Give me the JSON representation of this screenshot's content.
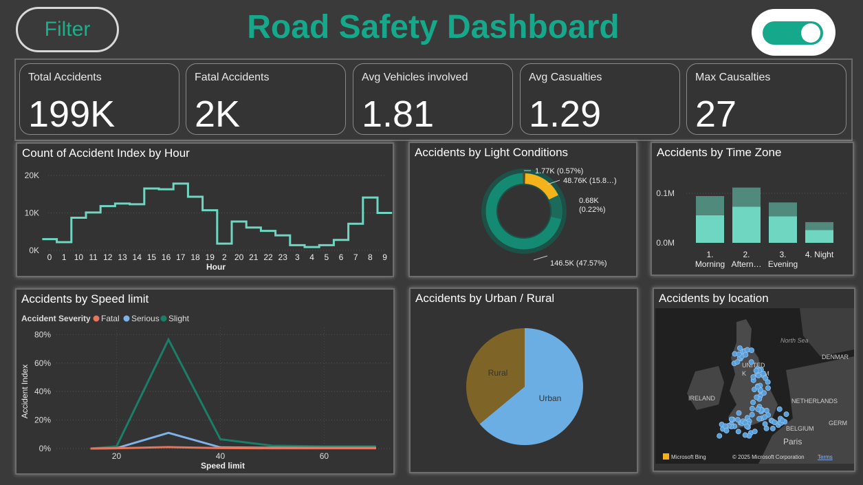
{
  "header": {
    "filter_label": "Filter",
    "title": "Road Safety Dashboard",
    "toggle_state": "on"
  },
  "kpis": [
    {
      "label": "Total Accidents",
      "value": "199K"
    },
    {
      "label": "Fatal Accidents",
      "value": "2K"
    },
    {
      "label": "Avg Vehicles involved",
      "value": "1.81"
    },
    {
      "label": "Avg Casualties",
      "value": "1.29"
    },
    {
      "label": "Max Causalties",
      "value": "27"
    }
  ],
  "colors": {
    "accent": "#16a88a",
    "line": "#6fd6c1",
    "fatal": "#e8745a",
    "serious": "#7fb2e6",
    "slight": "#1a7e68",
    "amber": "#f4b21b",
    "urban": "#6aaee3",
    "rural": "#7e6426"
  },
  "hour_chart": {
    "title": "Count of Accident Index by Hour",
    "chart_data": {
      "type": "line",
      "x": [
        "0",
        "1",
        "10",
        "11",
        "12",
        "13",
        "14",
        "15",
        "16",
        "17",
        "18",
        "19",
        "2",
        "20",
        "21",
        "22",
        "23",
        "3",
        "4",
        "5",
        "6",
        "7",
        "8",
        "9"
      ],
      "values": [
        3000,
        2200,
        8700,
        10100,
        11800,
        12500,
        12300,
        16500,
        16300,
        17800,
        14300,
        10700,
        1800,
        7700,
        6100,
        5200,
        4000,
        1400,
        900,
        1400,
        2800,
        7100,
        14100,
        10000
      ],
      "xlabel": "Hour",
      "yticks": [
        "0K",
        "10K",
        "20K"
      ],
      "ylim": [
        0,
        22000
      ]
    }
  },
  "light_chart": {
    "title": "Accidents by Light Conditions",
    "chart_data": {
      "type": "pie",
      "slices": [
        {
          "label": "1.77K (0.57%)",
          "value": 1.77
        },
        {
          "label": "48.76K (15.8…)",
          "value": 48.76
        },
        {
          "label": "0.68K (0.22%)",
          "value": 0.68
        },
        {
          "label": "146.5K (47.57%)",
          "value": 146.5
        }
      ]
    }
  },
  "timezone_chart": {
    "title": "Accidents by Time Zone",
    "chart_data": {
      "type": "bar",
      "categories": [
        "1. Morning",
        "2. Aftern…",
        "3. Evening",
        "4. Night"
      ],
      "category_lines": [
        [
          "1.",
          "Morning"
        ],
        [
          "2.",
          "Aftern…"
        ],
        [
          "3.",
          "Evening"
        ],
        [
          "4. Night",
          ""
        ]
      ],
      "series": [
        {
          "values": [
            0.052,
            0.068,
            0.05,
            0.024
          ]
        },
        {
          "values": [
            0.036,
            0.036,
            0.026,
            0.015
          ]
        }
      ],
      "yticks": [
        "0.0M",
        "0.1M"
      ],
      "ylim": [
        0,
        0.11
      ]
    }
  },
  "speed_chart": {
    "title": "Accidents by Speed limit",
    "legend_title": "Accident Severity",
    "chart_data": {
      "type": "line",
      "x": [
        15,
        20,
        30,
        40,
        50,
        60,
        70
      ],
      "series": [
        {
          "name": "Fatal",
          "values": [
            0,
            0.2,
            1,
            0.3,
            0.2,
            0.2,
            0.2
          ]
        },
        {
          "name": "Serious",
          "values": [
            0,
            0.3,
            11,
            0.8,
            0.6,
            0.5,
            0.5
          ]
        },
        {
          "name": "Slight",
          "values": [
            0,
            1.5,
            76.5,
            6.5,
            2,
            1.5,
            1.5
          ]
        }
      ],
      "xlabel": "Speed limit",
      "ylabel": "Accident Index",
      "yticks": [
        "0%",
        "20%",
        "40%",
        "60%",
        "80%"
      ],
      "xticks": [
        "20",
        "40",
        "60"
      ],
      "ylim": [
        0,
        85
      ],
      "xlim": [
        10,
        72
      ]
    }
  },
  "urban_chart": {
    "title": "Accidents by Urban / Rural",
    "chart_data": {
      "type": "pie",
      "slices": [
        {
          "label": "Urban",
          "value": 64
        },
        {
          "label": "Rural",
          "value": 36
        }
      ]
    }
  },
  "map_card": {
    "title": "Accidents by location",
    "labels": {
      "north_sea": "North Sea",
      "united": "UNITED",
      "kingdom": "K",
      "kingdom2": "M",
      "ireland": "IRELAND",
      "netherlands": "NETHERLANDS",
      "belgium": "BELGIUM",
      "germ": "GERM",
      "denmark": "DENMAR",
      "paris": "Paris"
    },
    "bing_label": "Microsoft Bing",
    "copyright": "© 2025 Microsoft Corporation",
    "terms": "Terms"
  }
}
